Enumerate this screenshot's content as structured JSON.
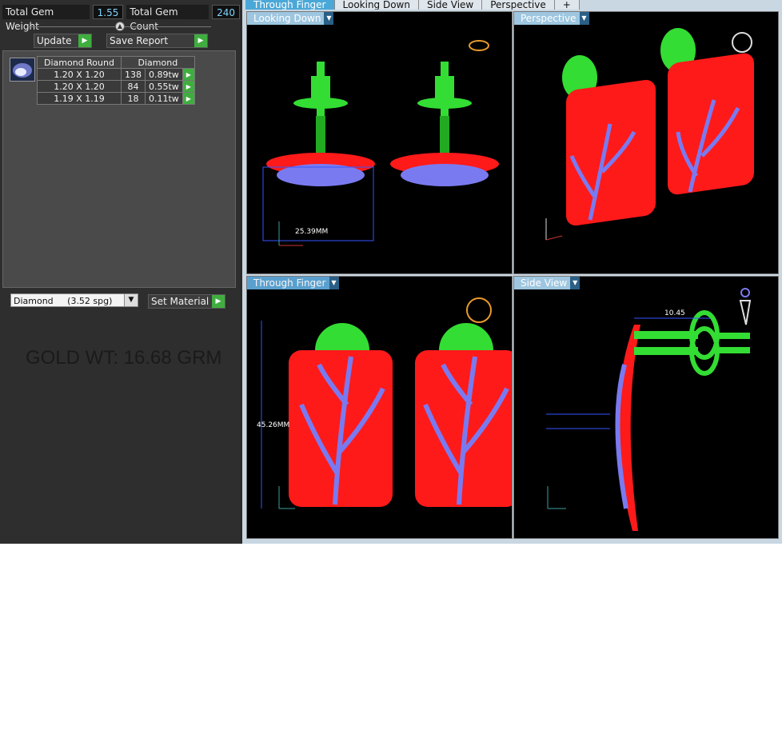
{
  "left_panel": {
    "total_gem_weight_label": "Total Gem Weight",
    "total_gem_weight": "1.55",
    "total_gem_count_label": "Total Gem Count",
    "total_gem_count": "240",
    "update_label": "Update",
    "save_report_label": "Save Report",
    "table": {
      "headers": [
        "Diamond Round",
        "Diamond"
      ],
      "rows": [
        {
          "size": "1.20 X 1.20",
          "count": "138",
          "weight": "0.89tw"
        },
        {
          "size": "1.20 X 1.20",
          "count": "84",
          "weight": "0.55tw"
        },
        {
          "size": "1.19 X 1.19",
          "count": "18",
          "weight": "0.11tw"
        }
      ]
    },
    "material_select": "Diamond     (3.52 spg)",
    "set_material_label": "Set Material",
    "gold_weight": "GOLD WT: 16.68 GRM"
  },
  "tabs": [
    "Through Finger",
    "Looking Down",
    "Side View",
    "Perspective",
    "+"
  ],
  "viewports": {
    "looking_down": {
      "label": "Looking Down",
      "dimension": "25.39MM"
    },
    "perspective": {
      "label": "Perspective"
    },
    "through_finger": {
      "label": "Through Finger",
      "dimension": "45.26MM"
    },
    "side_view": {
      "label": "Side View",
      "dimension": "10.45"
    }
  },
  "colors": {
    "metal_red": "#ff1a1a",
    "gem_blue": "#7a7af0",
    "post_green": "#33dd33",
    "active_tab": "#4aa8d8"
  }
}
